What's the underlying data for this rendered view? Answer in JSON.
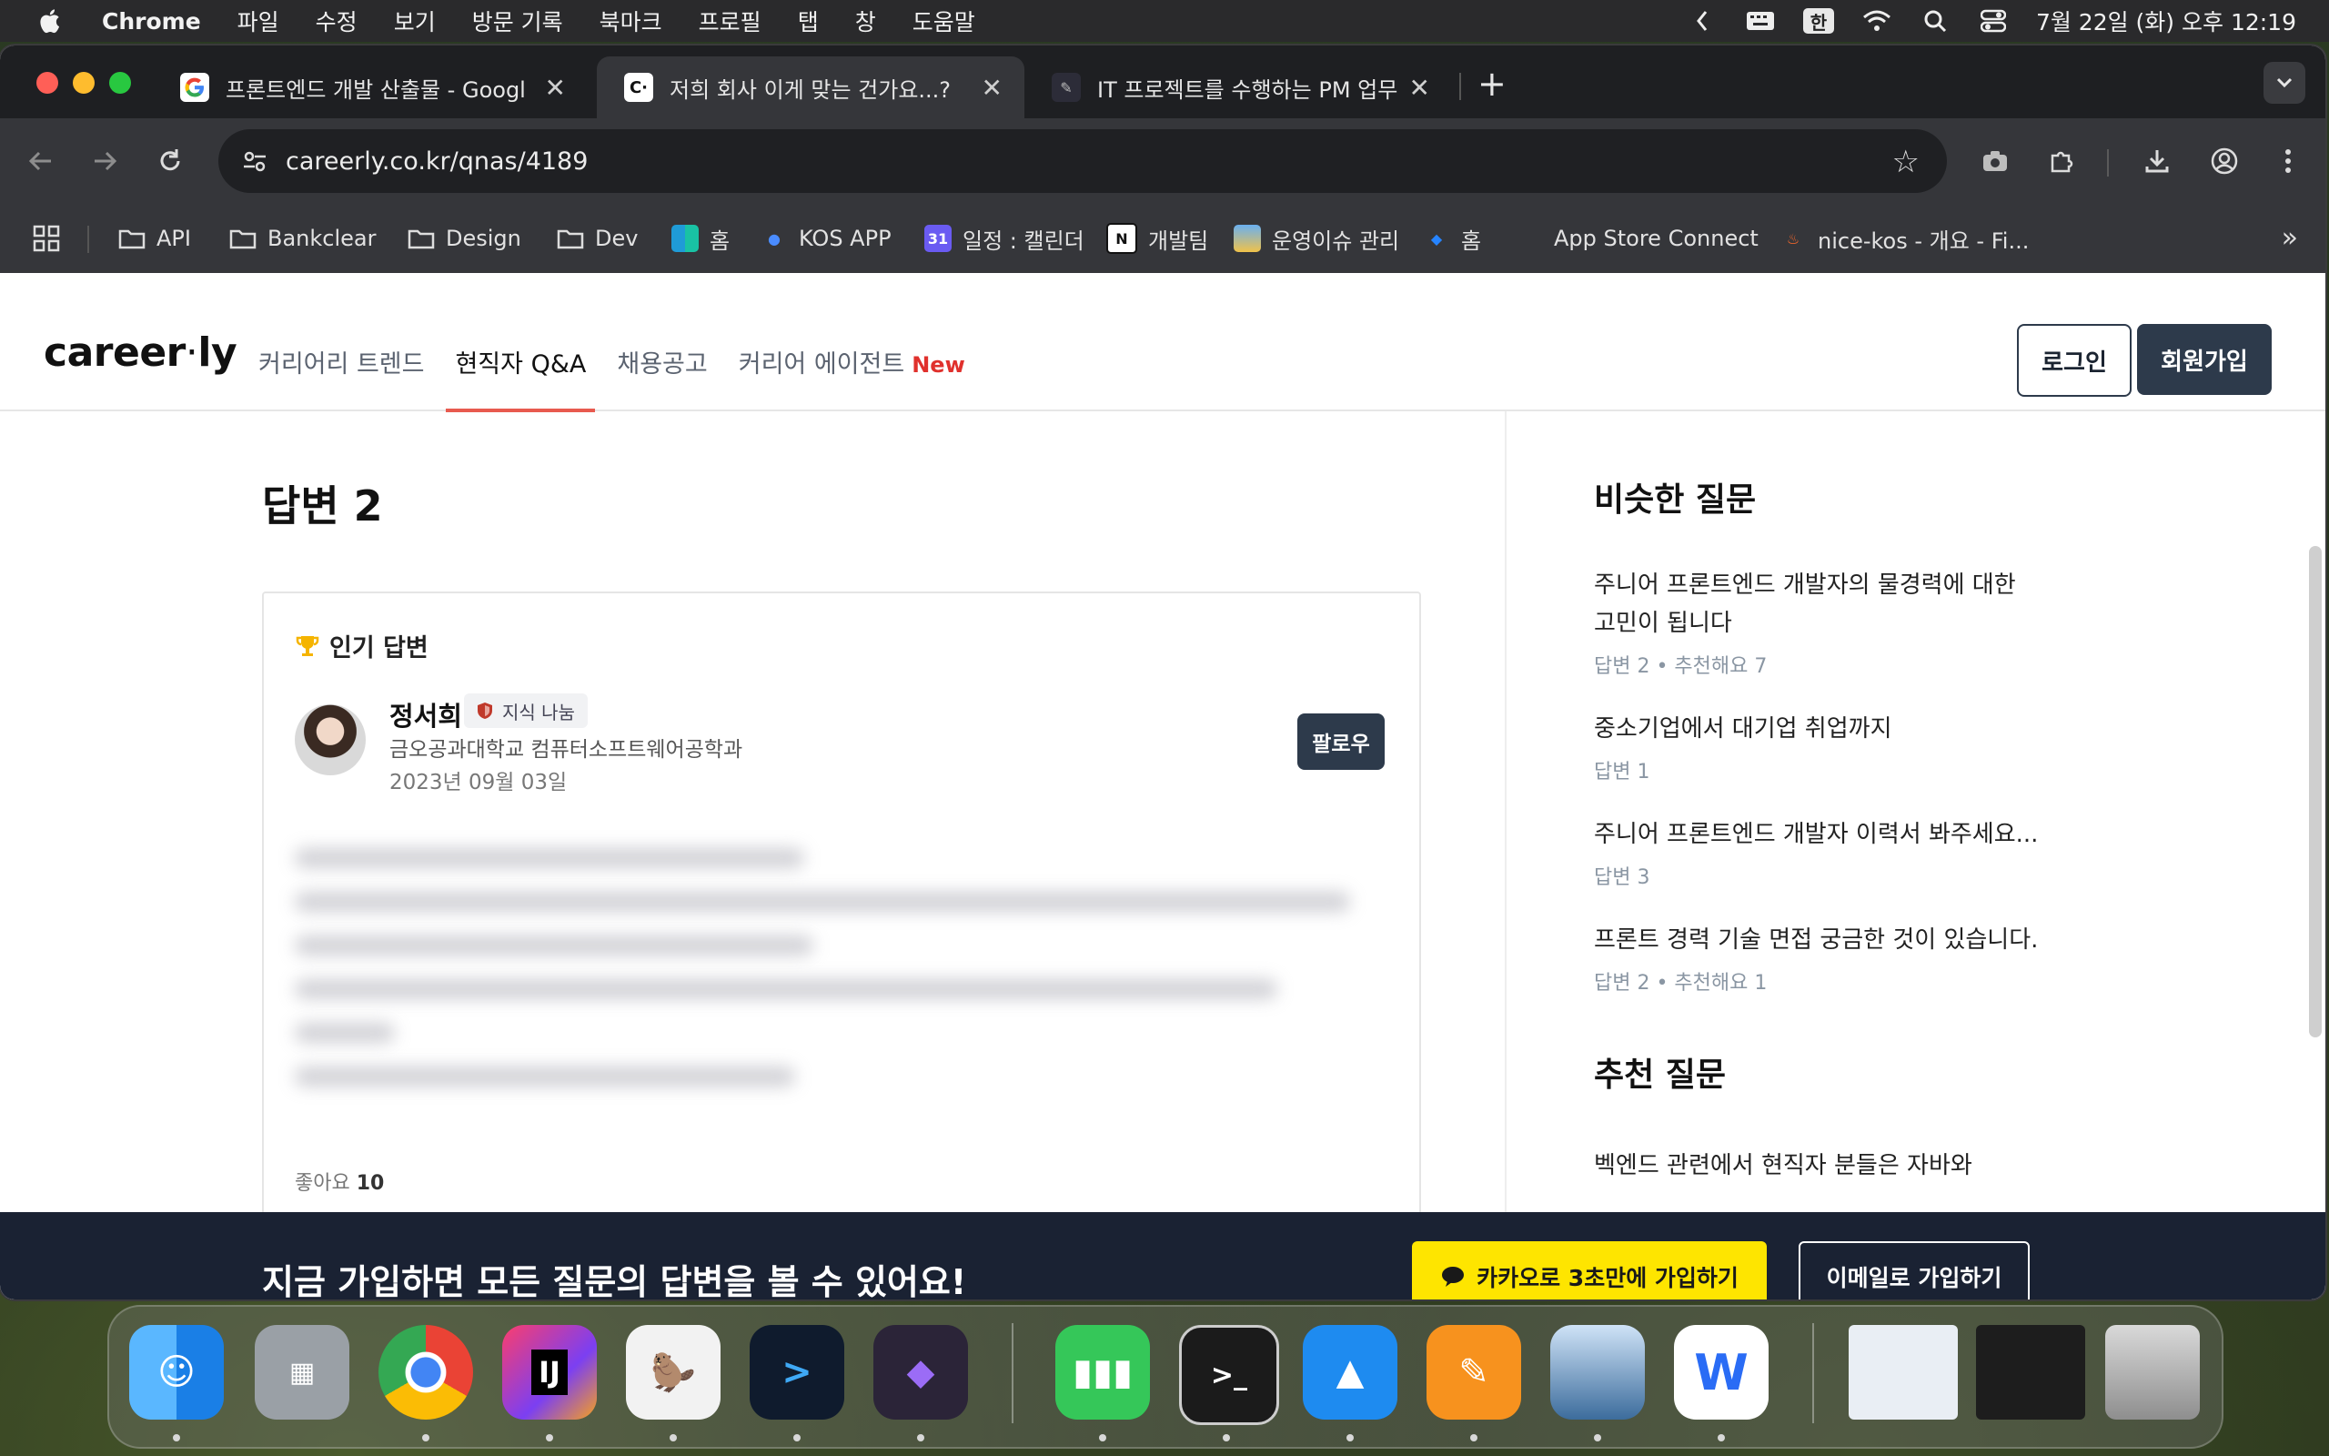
{
  "menubar": {
    "app_name": "Chrome",
    "menus": [
      "파일",
      "수정",
      "보기",
      "방문 기록",
      "북마크",
      "프로필",
      "탭",
      "창",
      "도움말"
    ],
    "ime": "한",
    "clock": "7월 22일 (화) 오후 12:19"
  },
  "tabs": [
    {
      "title": "프론트엔드 개발 산출물 - Google",
      "favicon": "google-icon",
      "active": false
    },
    {
      "title": "저희 회사 이게 맞는 건가요...?",
      "favicon": "careerly-icon",
      "active": true
    },
    {
      "title": "IT 프로젝트를 수행하는 PM 업무 &",
      "favicon": "pen-icon",
      "active": false
    }
  ],
  "toolbar": {
    "url": "careerly.co.kr/qnas/4189"
  },
  "bookmarks": [
    {
      "label": "API",
      "icon": "folder-icon"
    },
    {
      "label": "Bankclear",
      "icon": "folder-icon"
    },
    {
      "label": "Design",
      "icon": "folder-icon"
    },
    {
      "label": "Dev",
      "icon": "folder-icon"
    },
    {
      "label": "홈",
      "icon": "board-icon"
    },
    {
      "label": "KOS APP",
      "icon": "bot-icon"
    },
    {
      "label": "일정 : 캘린더",
      "icon": "calendar-icon",
      "badge": "31"
    },
    {
      "label": "개발팀",
      "icon": "notion-icon",
      "badge": "N"
    },
    {
      "label": "운영이슈 관리",
      "icon": "photo-icon"
    },
    {
      "label": "홈",
      "icon": "jira-icon"
    },
    {
      "label": "App Store Connect",
      "icon": "apple-icon"
    },
    {
      "label": "nice-kos - 개요 - Fi...",
      "icon": "flame-icon"
    }
  ],
  "site": {
    "logo_main": "career",
    "logo_dot": "·",
    "logo_tail": "ly",
    "nav": [
      "커리어리 트렌드",
      "현직자 Q&A",
      "채용공고",
      "커리어 에이전트"
    ],
    "nav_new_badge": "New",
    "login": "로그인",
    "signup": "회원가입"
  },
  "answers": {
    "title": "답변 2",
    "card": {
      "popular_label": "인기 답변",
      "author": "정서희",
      "badge": "지식 나눔",
      "school": "금오공과대학교 컴퓨터소프트웨어공학과",
      "date": "2023년 09월 03일",
      "follow": "팔로우",
      "likes_label": "좋아요",
      "likes_count": "10"
    }
  },
  "sidebar": {
    "similar_title": "비슷한 질문",
    "similar": [
      {
        "question": "주니어 프론트엔드 개발자의 물경력에 대한 고민이 됩니다",
        "meta": "답변 2 • 추천해요 7"
      },
      {
        "question": "중소기업에서 대기업 취업까지",
        "meta": "답변 1"
      },
      {
        "question": "주니어 프론트엔드 개발자 이력서 봐주세요...",
        "meta": "답변 3"
      },
      {
        "question": "프론트 경력 기술 면접 궁금한 것이 있습니다.",
        "meta": "답변 2 • 추천해요 1"
      }
    ],
    "recommended_title": "추천 질문",
    "recommended": [
      {
        "question": "벡엔드 관련에서 현직자 분들은 자바와"
      }
    ]
  },
  "cta": {
    "text": "지금 가입하면 모든 질문의 답변을 볼 수 있어요!",
    "kakao": "카카오로 3초만에 가입하기",
    "email": "이메일로 가입하기"
  },
  "dock": [
    {
      "name": "finder-icon",
      "color": "#2f8cf0"
    },
    {
      "name": "launchpad-icon",
      "color": "#9aa0a6"
    },
    {
      "name": "chrome-icon",
      "color": "#ffffff"
    },
    {
      "name": "intellij-icon",
      "color": "#fc3e6c"
    },
    {
      "name": "dbeaver-icon",
      "color": "#f2f2f2"
    },
    {
      "name": "sourcetree-icon",
      "color": "#0f1b2d"
    },
    {
      "name": "obsidian-icon",
      "color": "#2b2438"
    },
    {
      "name": "numbers-icon",
      "color": "#35c759"
    },
    {
      "name": "terminal-icon",
      "color": "#1b1b1b"
    },
    {
      "name": "keynote-icon",
      "color": "#1e8bf0"
    },
    {
      "name": "pages-icon",
      "color": "#f7921e"
    },
    {
      "name": "preview-icon",
      "color": "#dfe9f3"
    },
    {
      "name": "naver-whale-icon",
      "color": "#ffffff"
    }
  ],
  "colors": {
    "accent": "#e85a4f",
    "primary": "#2d3a4b",
    "cta_bg": "#1a2233",
    "kakao": "#fee500",
    "new_badge": "#e0312d"
  }
}
